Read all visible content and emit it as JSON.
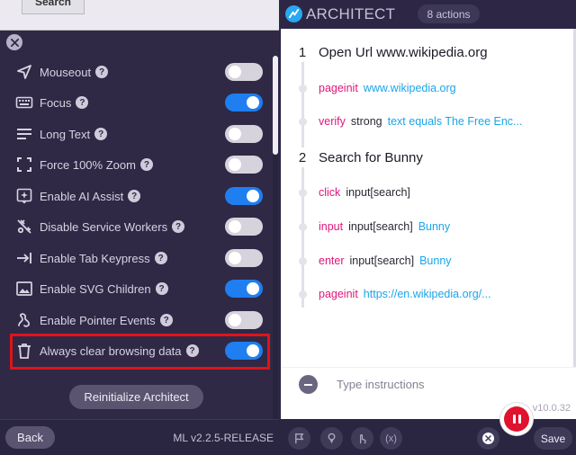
{
  "top_strip": {
    "search_label": "Search"
  },
  "settings": [
    {
      "label": "Mouseout",
      "icon": "cursor-icon",
      "on": false
    },
    {
      "label": "Focus",
      "icon": "keyboard-icon",
      "on": true
    },
    {
      "label": "Long Text",
      "icon": "text-lines-icon",
      "on": false
    },
    {
      "label": "Force 100% Zoom",
      "icon": "zoom-frame-icon",
      "on": false
    },
    {
      "label": "Enable AI Assist",
      "icon": "ai-sparkle-icon",
      "on": true
    },
    {
      "label": "Disable Service Workers",
      "icon": "service-worker-icon",
      "on": false
    },
    {
      "label": "Enable Tab Keypress",
      "icon": "tab-key-icon",
      "on": false
    },
    {
      "label": "Enable SVG Children",
      "icon": "image-icon",
      "on": true
    },
    {
      "label": "Enable Pointer Events",
      "icon": "pointer-events-icon",
      "on": false
    },
    {
      "label": "Always clear browsing data",
      "icon": "trash-icon",
      "on": true
    }
  ],
  "reinitialize_label": "Reinitialize Architect",
  "left_footer": {
    "back_label": "Back",
    "version": "ML v2.2.5-RELEASE"
  },
  "architect": {
    "title": "ARCHITECT",
    "actions_count": "8 actions",
    "steps": [
      {
        "number": "1",
        "title": "Open Url www.wikipedia.org",
        "actions": [
          {
            "verb": "pageinit",
            "target": "",
            "value": "www.wikipedia.org"
          },
          {
            "verb": "verify",
            "target": "strong",
            "value": "text equals The Free Enc..."
          }
        ]
      },
      {
        "number": "2",
        "title": "Search for Bunny",
        "actions": [
          {
            "verb": "click",
            "target": "input[search]",
            "value": ""
          },
          {
            "verb": "input",
            "target": "input[search]",
            "value": "Bunny"
          },
          {
            "verb": "enter",
            "target": "input[search]",
            "value": "Bunny"
          },
          {
            "verb": "pageinit",
            "target": "",
            "value": "https://en.wikipedia.org/..."
          }
        ]
      }
    ],
    "instructions_placeholder": "Type instructions",
    "version": "v10.0.32",
    "save_label": "Save",
    "variable_tool_label": "(x)"
  },
  "colors": {
    "toggle_on": "#1f7ef0",
    "toggle_off": "#d6d3dc",
    "verb": "#e0157b",
    "value": "#1aa5e8",
    "highlight": "#e01319",
    "record": "#e0122e"
  }
}
